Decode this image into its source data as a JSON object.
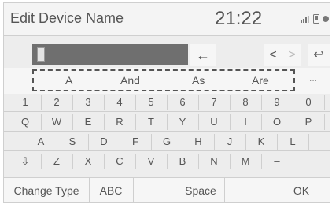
{
  "header": {
    "title": "Edit Device Name",
    "time": "21:22",
    "signal_icon": "signal-bars-icon",
    "phone_icon": "phone-icon"
  },
  "input": {
    "value": "",
    "backspace_label": "←",
    "left_label": "<",
    "right_label": ">",
    "undo_label": "↩"
  },
  "suggestions": {
    "items": [
      "A",
      "And",
      "As",
      "Are"
    ],
    "more_label": "..."
  },
  "keyboard": {
    "row1": [
      "1",
      "2",
      "3",
      "4",
      "5",
      "6",
      "7",
      "8",
      "9",
      "0"
    ],
    "row2": [
      "Q",
      "W",
      "E",
      "R",
      "T",
      "Y",
      "U",
      "I",
      "O",
      "P"
    ],
    "row3": [
      "A",
      "S",
      "D",
      "F",
      "G",
      "H",
      "J",
      "K",
      "L"
    ],
    "row4": [
      "⇩",
      "Z",
      "X",
      "C",
      "V",
      "B",
      "N",
      "M",
      "–"
    ]
  },
  "bottom": {
    "change_type": "Change Type",
    "abc": "ABC",
    "space": "Space",
    "ok": "OK"
  }
}
